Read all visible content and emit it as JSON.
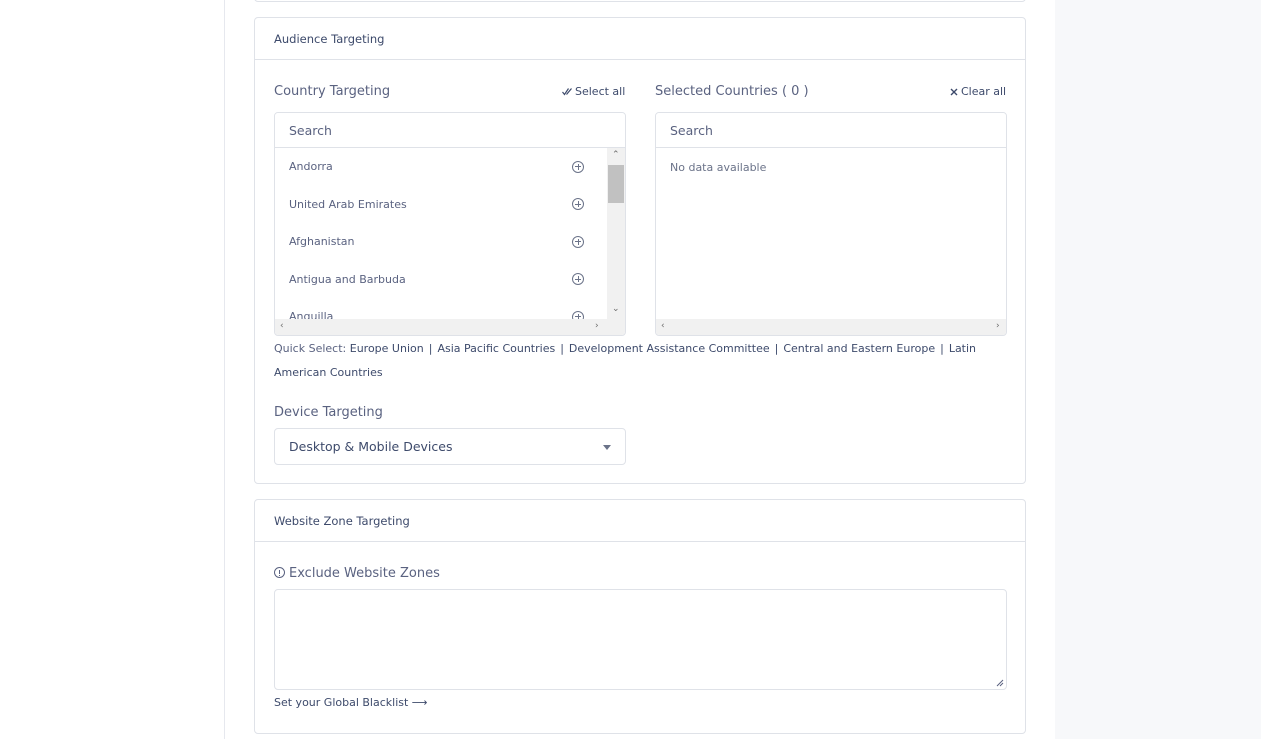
{
  "audience": {
    "title": "Audience Targeting",
    "country_label": "Country Targeting",
    "select_all_label": "Select all",
    "selected_label": "Selected Countries ( 0 )",
    "clear_all_label": "Clear all",
    "search_placeholder": "Search",
    "selected_search_placeholder": "Search",
    "countries": [
      "Andorra",
      "United Arab Emirates",
      "Afghanistan",
      "Antigua and Barbuda",
      "Anguilla"
    ],
    "no_data": "No data available",
    "quick_select_label": "Quick Select:",
    "quick_select": [
      "Europe Union",
      "Asia Pacific Countries",
      "Development Assistance Committee",
      "Central and Eastern Europe",
      "Latin American Countries"
    ],
    "device_label": "Device Targeting",
    "device_value": "Desktop & Mobile Devices"
  },
  "zone": {
    "title": "Website Zone Targeting",
    "exclude_label": "Exclude Website Zones",
    "blacklist_link": "Set your Global Blacklist ⟶"
  }
}
